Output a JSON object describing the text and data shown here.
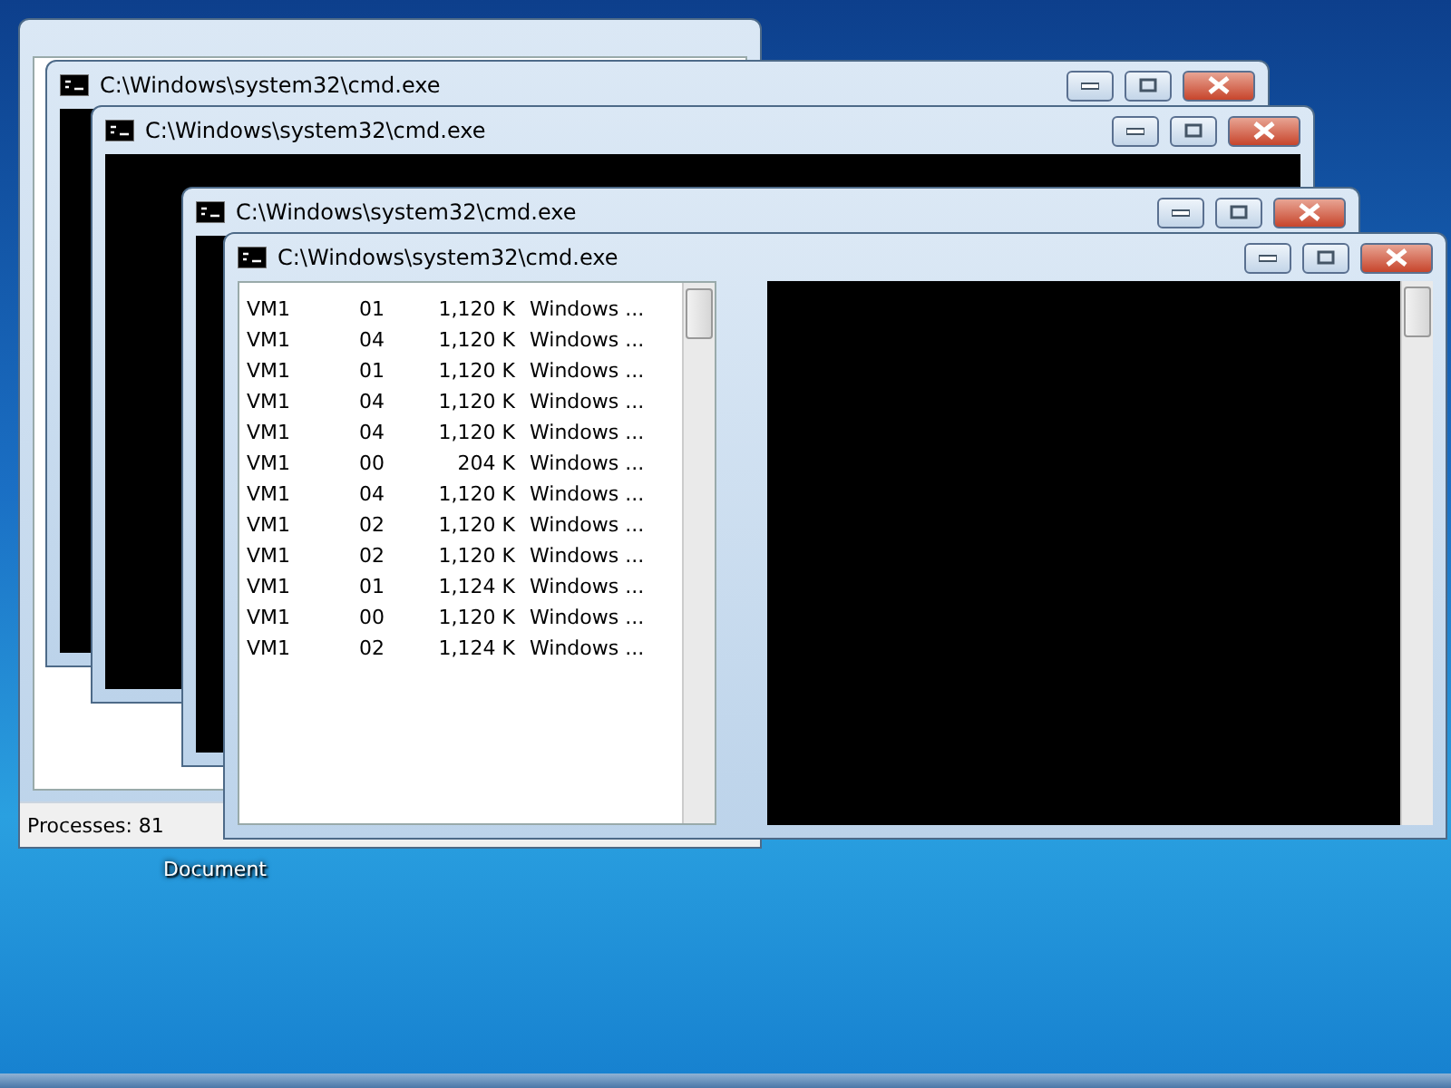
{
  "desktop": {
    "icon_label": "Document"
  },
  "task_manager": {
    "status": "Processes: 81"
  },
  "windows": [
    {
      "title": "C:\\Windows\\system32\\cmd.exe"
    },
    {
      "title": "C:\\Windows\\system32\\cmd.exe"
    },
    {
      "title": "C:\\Windows\\system32\\cmd.exe"
    },
    {
      "title": "C:\\Windows\\system32\\cmd.exe"
    }
  ],
  "process_table": {
    "rows": [
      {
        "user": "VM1",
        "cpu": "01",
        "memory": "1,120 K",
        "description": "Windows ..."
      },
      {
        "user": "VM1",
        "cpu": "04",
        "memory": "1,120 K",
        "description": "Windows ..."
      },
      {
        "user": "VM1",
        "cpu": "01",
        "memory": "1,120 K",
        "description": "Windows ..."
      },
      {
        "user": "VM1",
        "cpu": "04",
        "memory": "1,120 K",
        "description": "Windows ..."
      },
      {
        "user": "VM1",
        "cpu": "04",
        "memory": "1,120 K",
        "description": "Windows ..."
      },
      {
        "user": "VM1",
        "cpu": "00",
        "memory": "204 K",
        "description": "Windows ..."
      },
      {
        "user": "VM1",
        "cpu": "04",
        "memory": "1,120 K",
        "description": "Windows ..."
      },
      {
        "user": "VM1",
        "cpu": "02",
        "memory": "1,120 K",
        "description": "Windows ..."
      },
      {
        "user": "VM1",
        "cpu": "02",
        "memory": "1,120 K",
        "description": "Windows ..."
      },
      {
        "user": "VM1",
        "cpu": "01",
        "memory": "1,124 K",
        "description": "Windows ..."
      },
      {
        "user": "VM1",
        "cpu": "00",
        "memory": "1,120 K",
        "description": "Windows ..."
      },
      {
        "user": "VM1",
        "cpu": "02",
        "memory": "1,124 K",
        "description": "Windows ..."
      }
    ]
  }
}
